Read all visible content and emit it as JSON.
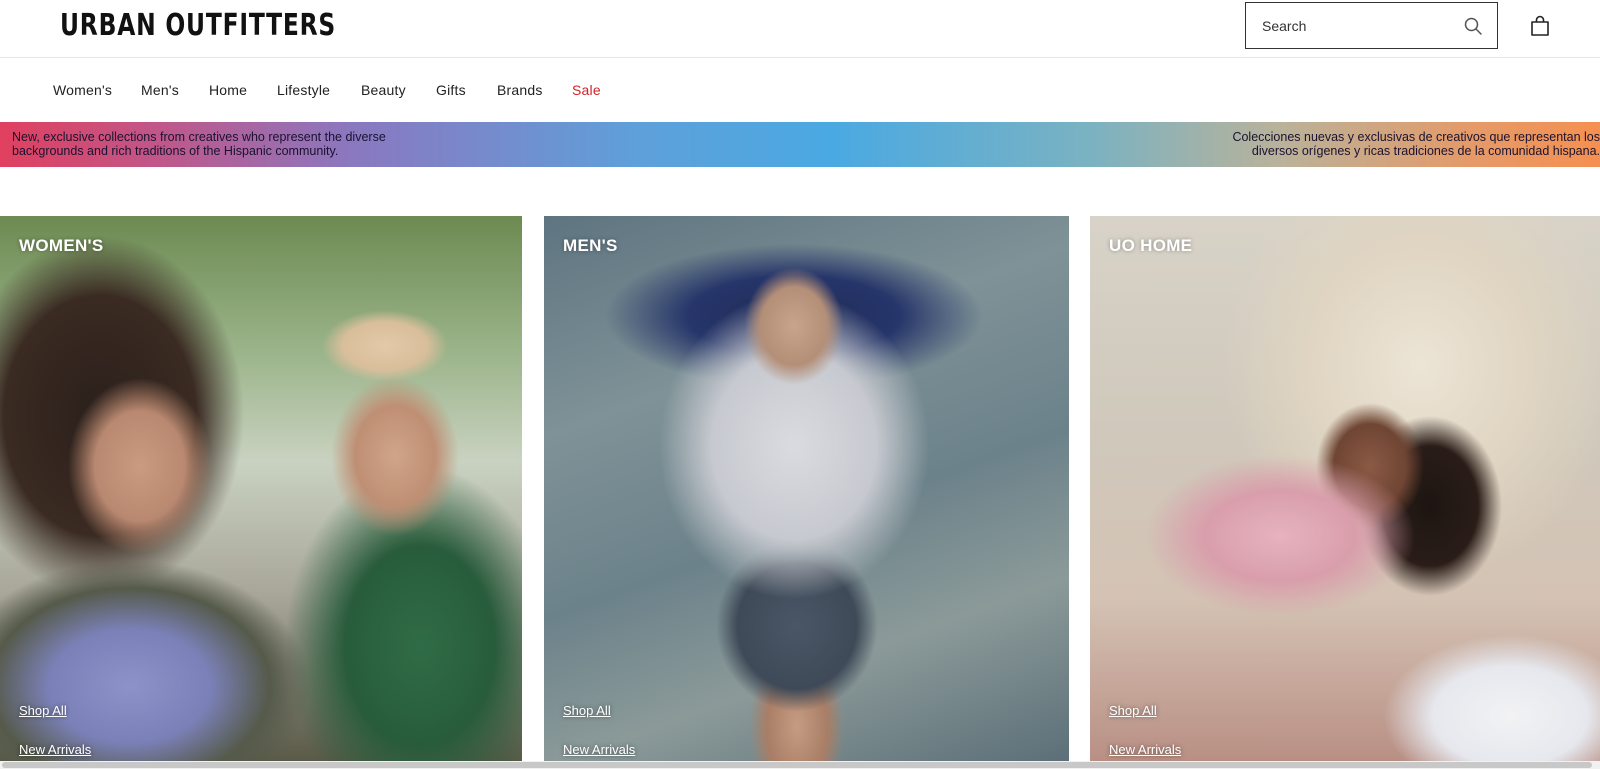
{
  "header": {
    "logo": "URBAN OUTFITTERS",
    "search": {
      "placeholder": "Search",
      "value": ""
    },
    "icons": {
      "search": "search-icon",
      "bag": "shopping-bag-icon"
    }
  },
  "nav": {
    "items": [
      {
        "label": "Women's"
      },
      {
        "label": "Men's"
      },
      {
        "label": "Home"
      },
      {
        "label": "Lifestyle"
      },
      {
        "label": "Beauty"
      },
      {
        "label": "Gifts"
      },
      {
        "label": "Brands"
      },
      {
        "label": "Sale"
      }
    ],
    "sale_color": "#d2232a"
  },
  "banner": {
    "left_line1": "New, exclusive collections from creatives who represent the diverse",
    "left_line2": "backgrounds and rich traditions of the Hispanic community.",
    "right_line1": "Colecciones nuevas y exclusivas de creativos que representan los",
    "right_line2": "diversos orígenes y ricas tradiciones de la comunidad hispana."
  },
  "cards": [
    {
      "title": "WOMEN'S",
      "shop_all": "Shop All",
      "new_arrivals": "New Arrivals"
    },
    {
      "title": "MEN'S",
      "shop_all": "Shop All",
      "new_arrivals": "New Arrivals"
    },
    {
      "title": "UO HOME",
      "shop_all": "Shop All",
      "new_arrivals": "New Arrivals"
    }
  ]
}
